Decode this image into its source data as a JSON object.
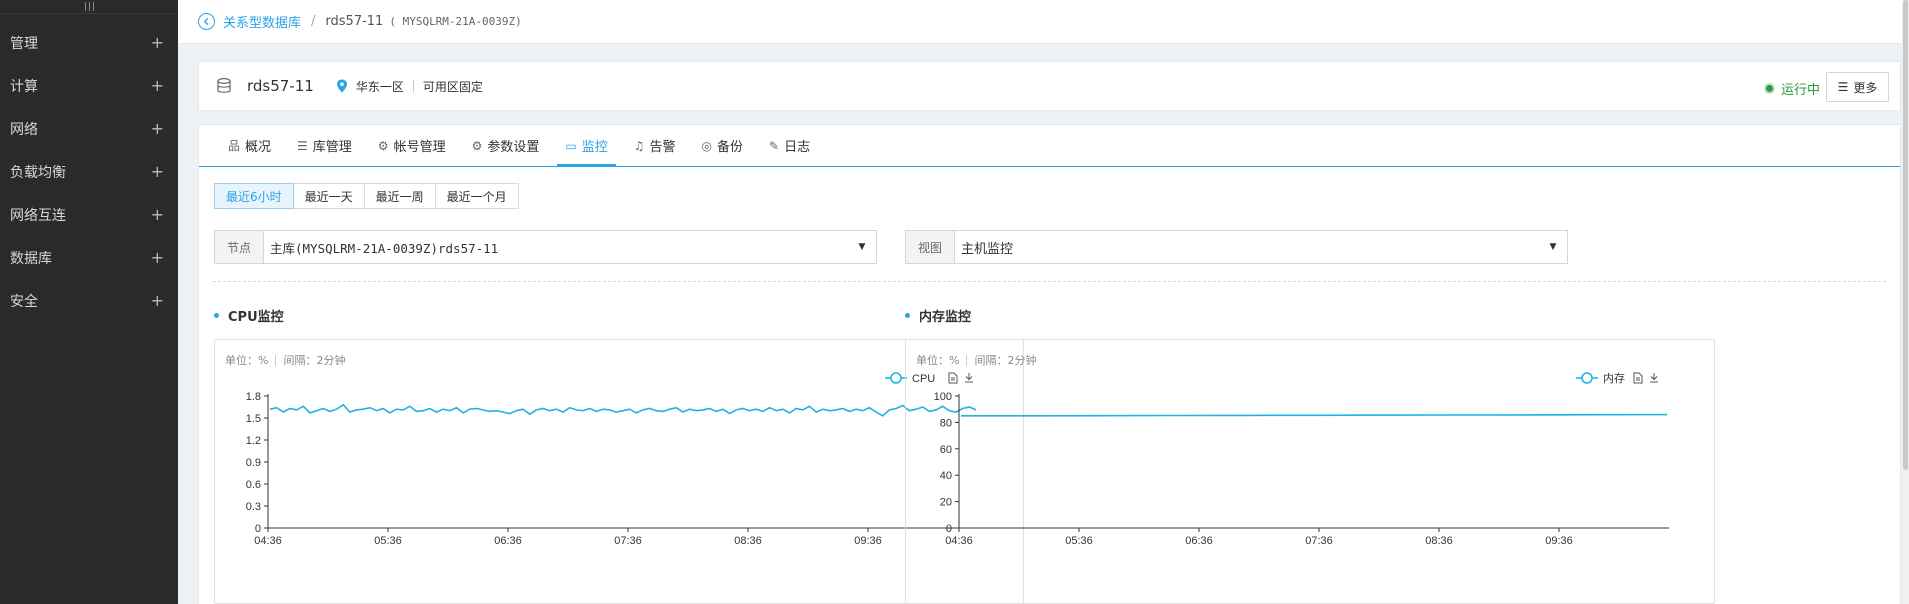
{
  "sidebar": {
    "items": [
      {
        "label": "管理"
      },
      {
        "label": "计算"
      },
      {
        "label": "网络"
      },
      {
        "label": "负载均衡"
      },
      {
        "label": "网络互连"
      },
      {
        "label": "数据库"
      },
      {
        "label": "安全"
      }
    ],
    "expand_symbol": "+"
  },
  "breadcrumb": {
    "parent": "关系型数据库",
    "separator": "/",
    "current": "rds57-11",
    "code": "( MYSQLRM-21A-0039Z)"
  },
  "instance": {
    "name": "rds57-11",
    "region": "华东一区",
    "zone": "可用区固定",
    "status": "运行中",
    "more_label": "更多",
    "status_color": "#2d9b3c"
  },
  "tabs": [
    {
      "label": "概况",
      "icon": "overview-icon",
      "glyph": "品"
    },
    {
      "label": "库管理",
      "icon": "database-icon",
      "glyph": "☰"
    },
    {
      "label": "帐号管理",
      "icon": "account-icon",
      "glyph": "⚙"
    },
    {
      "label": "参数设置",
      "icon": "settings-icon",
      "glyph": "⚙"
    },
    {
      "label": "监控",
      "icon": "monitor-icon",
      "glyph": "▭",
      "active": true
    },
    {
      "label": "告警",
      "icon": "bell-icon",
      "glyph": "♫"
    },
    {
      "label": "备份",
      "icon": "backup-icon",
      "glyph": "◎"
    },
    {
      "label": "日志",
      "icon": "log-icon",
      "glyph": "✎"
    }
  ],
  "ranges": [
    {
      "label": "最近6小时",
      "active": true
    },
    {
      "label": "最近一天"
    },
    {
      "label": "最近一周"
    },
    {
      "label": "最近一个月"
    }
  ],
  "node_selector": {
    "label": "节点",
    "value": "主库(MYSQLRM-21A-0039Z)rds57-11"
  },
  "view_selector": {
    "label": "视图",
    "value": "主机监控"
  },
  "charts": {
    "cpu": {
      "title": "CPU监控",
      "unit_text": "单位：%",
      "interval_text": "间隔：2分钟"
    },
    "mem": {
      "title": "内存监控",
      "unit_text": "单位：%",
      "interval_text": "间隔：2分钟"
    }
  },
  "accent_color": "#2ba3e8",
  "chart_data": [
    {
      "type": "line",
      "x": [
        "04:36",
        "05:36",
        "06:36",
        "07:36",
        "08:36",
        "09:36"
      ],
      "ylim": [
        0,
        1.8
      ],
      "yticks": [
        0,
        0.3,
        0.6,
        0.9,
        1.2,
        1.5,
        1.8
      ],
      "series": [
        {
          "name": "CPU",
          "color": "#1fb3e0",
          "values": [
            1.62,
            1.64,
            1.58,
            1.63,
            1.61,
            1.66,
            1.57,
            1.6,
            1.63,
            1.59,
            1.62,
            1.68,
            1.58,
            1.61,
            1.62,
            1.64,
            1.6,
            1.63,
            1.57,
            1.62,
            1.61,
            1.66,
            1.59,
            1.6,
            1.63,
            1.58,
            1.62,
            1.6,
            1.64,
            1.57,
            1.62,
            1.63,
            1.61,
            1.59,
            1.6,
            1.58,
            1.56,
            1.6,
            1.62,
            1.55,
            1.61,
            1.63,
            1.6,
            1.62,
            1.58,
            1.64,
            1.61,
            1.6,
            1.63,
            1.59,
            1.62,
            1.61,
            1.58,
            1.6,
            1.62,
            1.57,
            1.61,
            1.63,
            1.6,
            1.59,
            1.62,
            1.64,
            1.58,
            1.62,
            1.6,
            1.61,
            1.63,
            1.59,
            1.62,
            1.56,
            1.61,
            1.63,
            1.6,
            1.62,
            1.59,
            1.64,
            1.6,
            1.62,
            1.57,
            1.63,
            1.61,
            1.66,
            1.58,
            1.62,
            1.6,
            1.61,
            1.63,
            1.59,
            1.62,
            1.6,
            1.64,
            1.58,
            1.53,
            1.61,
            1.63,
            1.67,
            1.6,
            1.62,
            1.65,
            1.59,
            1.61,
            1.66,
            1.6,
            1.58,
            1.63,
            1.65,
            1.61
          ]
        }
      ]
    },
    {
      "type": "line",
      "x": [
        "04:36",
        "05:36",
        "06:36",
        "07:36",
        "08:36",
        "09:36"
      ],
      "ylim": [
        0,
        100
      ],
      "yticks": [
        0,
        20,
        40,
        60,
        80,
        100
      ],
      "series": [
        {
          "name": "内存",
          "color": "#1fb3e0",
          "values": [
            85.0,
            85.0,
            85.1,
            85.2,
            85.3,
            85.4,
            85.5,
            85.6,
            85.7,
            85.8,
            85.9
          ]
        }
      ]
    }
  ]
}
